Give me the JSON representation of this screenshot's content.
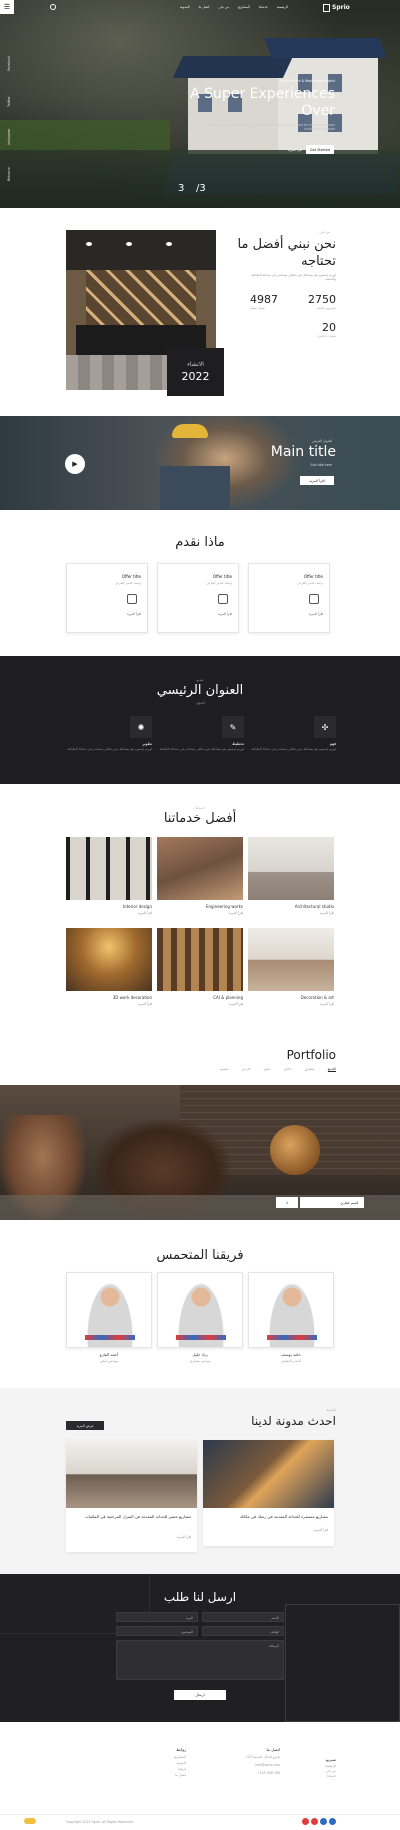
{
  "header": {
    "logo": "Sprio",
    "nav": [
      "الرئيسية",
      "خدماتنا",
      "المشاريع",
      "من نحن",
      "اتصل بنا",
      "المدونة"
    ]
  },
  "hero": {
    "kicker": "Architecture & Real Estate Project",
    "title_line1": "A Super Experiences",
    "title_line2": "Over",
    "desc": "Lorem ipsum dolor sit amet, consectetur adipiscing elit sed do eiusmod tempor incididunt ut labore",
    "btn_more": "اقرأ المزيد",
    "btn_contact": "Get Started",
    "counter": "3",
    "counter_total": "/3",
    "side_social": [
      "Facebook",
      "Twitter",
      "Instagram",
      "Behance"
    ]
  },
  "about": {
    "kicker": "من نحن",
    "title": "نحن نبني أفضل ما تحتاجه",
    "desc": "لوريم إيبسوم هو ببساطة نص شكلي يستخدم في صناعة الطباعة والتنضيد",
    "badge_label": "الانشاء",
    "badge_year": "2022",
    "stats": [
      {
        "value": "2750",
        "label": "مشروع مكتمل"
      },
      {
        "value": "4987",
        "label": "عميل سعيد"
      },
      {
        "value": "20",
        "label": "سنوات الخبرة"
      }
    ]
  },
  "video": {
    "kicker": "العنوان الفرعي",
    "title": "Main title",
    "sub": "Sub title here",
    "btn": "اقرأ المزيد"
  },
  "offers": {
    "title": "ماذا نقدم",
    "cards": [
      {
        "title": "Offer title",
        "desc": "وصف قصير للعرض",
        "link": "اقرأ المزيد"
      },
      {
        "title": "Offer title",
        "desc": "وصف قصير للعرض",
        "link": "اقرأ المزيد"
      },
      {
        "title": "Offer title",
        "desc": "وصف قصير للعرض",
        "link": "اقرأ المزيد"
      }
    ]
  },
  "features": {
    "kicker": "فيديو",
    "title": "العنوان الرئيسي",
    "sub": "العنوان",
    "items": [
      {
        "title": "فهم",
        "desc": "لوريم إيبسوم هو ببساطة نص شكلي يستخدم في صناعة الطباعة"
      },
      {
        "title": "تخطيط",
        "desc": "لوريم إيبسوم هو ببساطة نص شكلي يستخدم في صناعة الطباعة"
      },
      {
        "title": "تطوير",
        "desc": "لوريم إيبسوم هو ببساطة نص شكلي يستخدم في صناعة الطباعة"
      }
    ]
  },
  "services": {
    "kicker": "خدماتنا",
    "title": "أفضل خدماتنا",
    "items": [
      {
        "title": "Architectural studio",
        "link": "اقرأ المزيد"
      },
      {
        "title": "Engineering works",
        "link": "اقرأ المزيد"
      },
      {
        "title": "Interior design",
        "link": "اقرأ المزيد"
      },
      {
        "title": "Decoration & art",
        "link": "اقرأ المزيد"
      },
      {
        "title": "CAI & planning",
        "link": "اقرأ المزيد"
      },
      {
        "title": "3D work decoration",
        "link": "اقرأ المزيد"
      }
    ]
  },
  "portfolio": {
    "title": "Portfolio",
    "tabs": [
      "الجميع",
      "معماري",
      "داخلي",
      "ديكور",
      "خارجي",
      "تصميم"
    ],
    "item_label": "قسم عقاري",
    "item_num": "1"
  },
  "team": {
    "title": "فريقنا المتحمس",
    "members": [
      {
        "name": "حامد يوسف",
        "role": "المدير التنفيذي"
      },
      {
        "name": "زياد خليل",
        "role": "مهندس معماري"
      },
      {
        "name": "أحمد الفارو",
        "role": "مهندس ديكور"
      }
    ]
  },
  "blog": {
    "kicker": "المدونة",
    "title": "احدث مدونة لدينا",
    "btn": "عرض المزيد",
    "posts": [
      {
        "title": "مشاريع مستمرة للحداثة المقدمة في زمنك في مكانك",
        "link": "اقرأ المزيد"
      },
      {
        "title": "مشاريع متميز للحداثة المقدمة في المنزل المرجعية في المكتبات",
        "link": "اقرأ المزيد"
      }
    ]
  },
  "contact": {
    "title": "ارسل لنا طلب",
    "fields": [
      "الاسم",
      "البريد",
      "الهاتف",
      "الموضوع",
      "الرسالة"
    ],
    "submit": "ارسال"
  },
  "footer": {
    "col1_title": "سبريو",
    "col1_lines": [
      "الرئيسية",
      "من نحن",
      "خدماتنا"
    ],
    "col2_title": "اتصل بنا",
    "col2_lines": [
      "123 شارع المثال، المدينة",
      "info@sprio.com",
      "+123 456 789"
    ],
    "col3_title": "روابط",
    "col3_lines": [
      "المشاريع",
      "المدونة",
      "فريقنا",
      "اتصل بنا"
    ],
    "copyright": "Copyright 2022 Sprio. All Rights Reserved"
  },
  "colors": {
    "dark": "#1e1e20",
    "accent": "#c8a16a",
    "red": "#e23b3b",
    "blue": "#2f6bc1"
  }
}
